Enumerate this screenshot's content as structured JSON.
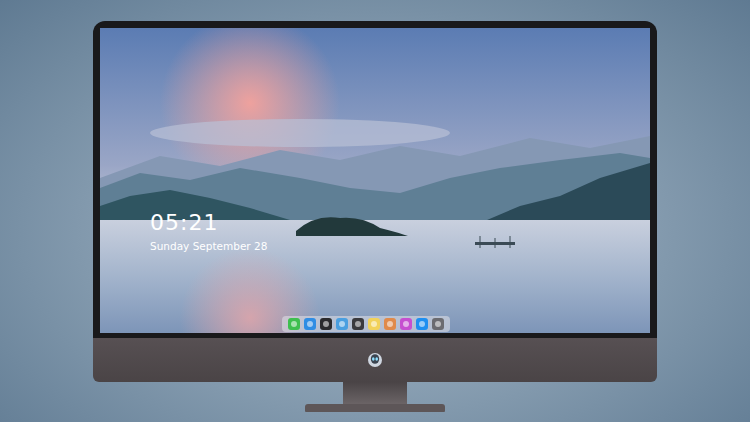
{
  "screen": {
    "clock": {
      "time": "05:21",
      "date": "Sunday September 28"
    }
  },
  "dock": {
    "items": [
      {
        "color": "#3fbf4f"
      },
      {
        "color": "#2f8de4"
      },
      {
        "color": "#2b2b2e"
      },
      {
        "color": "#4a9fe0"
      },
      {
        "color": "#3a3a3e"
      },
      {
        "color": "#f2d25a"
      },
      {
        "color": "#e08a4a"
      },
      {
        "color": "#c64fd0"
      },
      {
        "color": "#1f8ff0"
      },
      {
        "color": "#6b6b70"
      }
    ]
  }
}
